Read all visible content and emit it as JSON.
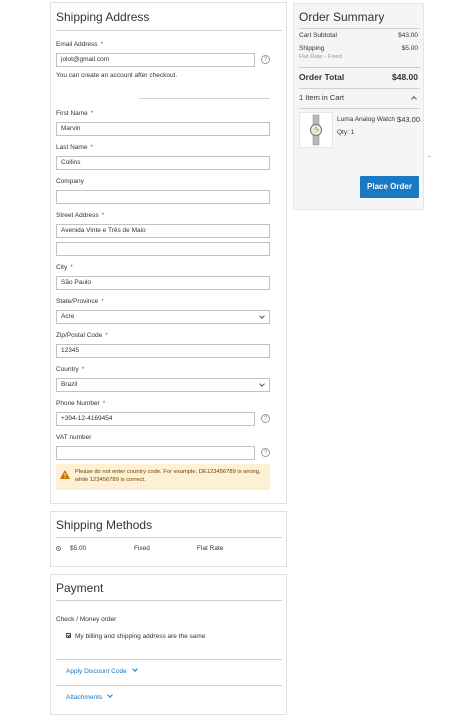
{
  "shipping_address": {
    "title": "Shipping Address",
    "email": {
      "label": "Email Address",
      "value": "jolot@gmail.com"
    },
    "email_note": "You can create an account after checkout.",
    "first_name": {
      "label": "First Name",
      "value": "Marvin"
    },
    "last_name": {
      "label": "Last Name",
      "value": "Collins"
    },
    "company": {
      "label": "Company",
      "value": ""
    },
    "street": {
      "label": "Street Address",
      "value": "Avenida Vinte e Três de Maio",
      "line2": ""
    },
    "city": {
      "label": "City",
      "value": "São Paulo"
    },
    "state": {
      "label": "State/Province",
      "value": "Acre"
    },
    "zip": {
      "label": "Zip/Postal Code",
      "value": "12345"
    },
    "country": {
      "label": "Country",
      "value": "Brazil"
    },
    "phone": {
      "label": "Phone Number",
      "value": "+394-12-4169454"
    },
    "vat": {
      "label": "VAT number",
      "value": ""
    },
    "vat_warning": "Please do not enter country code. For example, DE123456789 is wrong, while 123456789 is correct.",
    "required_mark": "*",
    "help_glyph": "?"
  },
  "shipping_methods": {
    "title": "Shipping Methods",
    "options": [
      {
        "price": "$5.00",
        "method": "Fixed",
        "carrier": "Flat Rate"
      }
    ]
  },
  "payment": {
    "title": "Payment",
    "method": "Check / Money order",
    "billing_same": "My billing and shipping address are the same",
    "discount_link": "Apply Discount Code",
    "attachments_link": "Attachments"
  },
  "order_summary": {
    "title": "Order Summary",
    "cart_subtotal_label": "Cart Subtotal",
    "cart_subtotal_value": "$43.00",
    "shipping_label": "Shipping",
    "shipping_value": "$5.00",
    "shipping_detail": "Flat Rate - Fixed",
    "total_label": "Order Total",
    "total_value": "$48.00",
    "items_in_cart": "1 Item in Cart",
    "item": {
      "name": "Luma Analog Watch",
      "price": "$43.00",
      "qty": "Qty: 1"
    },
    "place_order_label": "Place Order"
  },
  "colors": {
    "accent": "#1979c3",
    "required": "#e02b27",
    "warning_bg": "#fdf0d5"
  }
}
